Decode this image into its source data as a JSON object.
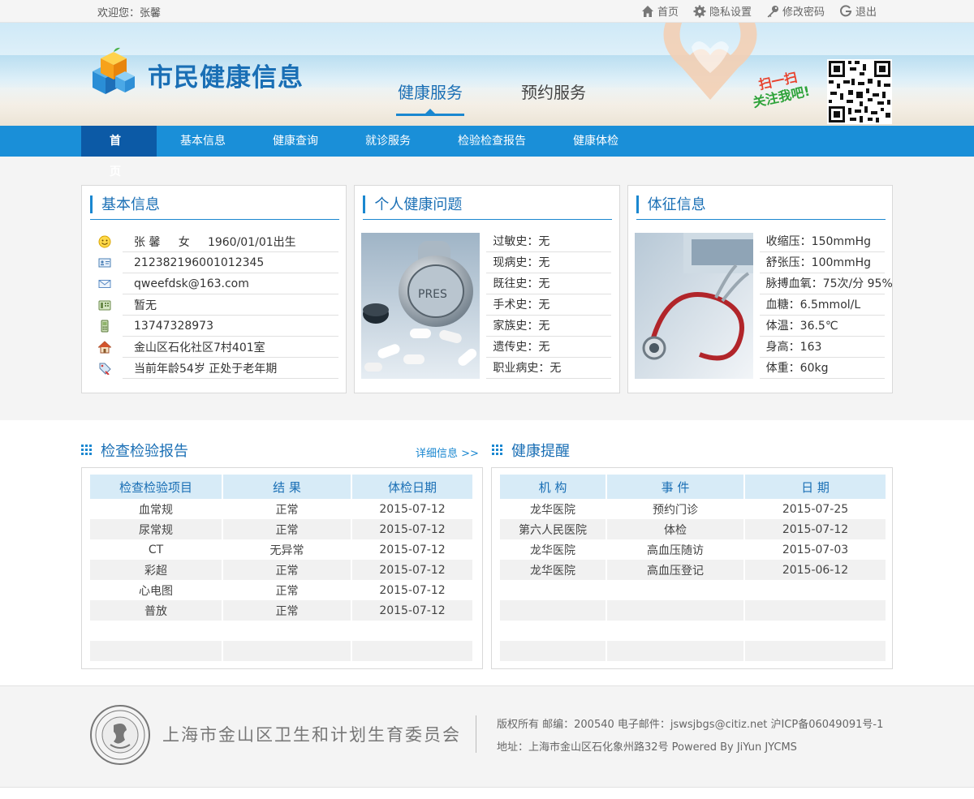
{
  "topbar": {
    "welcome": "欢迎您：张馨",
    "links": [
      {
        "icon": "home-icon",
        "label": "首页"
      },
      {
        "icon": "gear-icon",
        "label": "隐私设置"
      },
      {
        "icon": "key-icon",
        "label": "修改密码"
      },
      {
        "icon": "logout-icon",
        "label": "退出"
      }
    ]
  },
  "header": {
    "title": "市民健康信息",
    "service_tabs": [
      "健康服务",
      "预约服务"
    ],
    "active_service_tab": 0,
    "scan_line1": "扫一扫",
    "scan_line2": "关注我吧!"
  },
  "nav": {
    "items": [
      "首 页",
      "基本信息",
      "健康查询",
      "就诊服务",
      "检验检查报告",
      "健康体检"
    ],
    "active": 0,
    "color": "#1a8fd8",
    "active_color": "#0c5aa6"
  },
  "basic_info": {
    "title": "基本信息",
    "rows": [
      {
        "icon": "smiley-icon",
        "text": "张 馨     女     1960/01/01出生"
      },
      {
        "icon": "id-card-icon",
        "text": "212382196001012345"
      },
      {
        "icon": "envelope-icon",
        "text": "qweefdsk@163.com"
      },
      {
        "icon": "phone-icon",
        "text": "暂无"
      },
      {
        "icon": "mobile-icon",
        "text": "13747328973"
      },
      {
        "icon": "house-icon",
        "text": "金山区石化社区7村401室"
      },
      {
        "icon": "tag-icon",
        "text": "当前年龄54岁 正处于老年期"
      }
    ]
  },
  "health_problems": {
    "title": "个人健康问题",
    "rows": [
      "过敏史：无",
      "现病史：无",
      "既往史：无",
      "手术史：无",
      "家族史：无",
      "遗传史：无",
      "职业病史：无"
    ]
  },
  "vital_signs": {
    "title": "体征信息",
    "rows": [
      "收缩压：150mmHg",
      "舒张压：100mmHg",
      "脉搏血氧：75次/分 95%",
      "血糖：6.5mmol/L",
      "体温：36.5℃",
      "身高：163",
      "体重：60kg"
    ]
  },
  "exam_reports": {
    "title": "检查检验报告",
    "more": "详细信息 >>",
    "headers": [
      "检查检验项目",
      "结 果",
      "体检日期"
    ],
    "rows": [
      [
        "血常规",
        "正常",
        "2015-07-12"
      ],
      [
        "尿常规",
        "正常",
        "2015-07-12"
      ],
      [
        "CT",
        "无异常",
        "2015-07-12"
      ],
      [
        "彩超",
        "正常",
        "2015-07-12"
      ],
      [
        "心电图",
        "正常",
        "2015-07-12"
      ],
      [
        "普放",
        "正常",
        "2015-07-12"
      ],
      [
        "",
        "",
        ""
      ],
      [
        "",
        "",
        ""
      ]
    ]
  },
  "reminders": {
    "title": "健康提醒",
    "headers": [
      "机 构",
      "事 件",
      "日 期"
    ],
    "rows": [
      [
        "龙华医院",
        "预约门诊",
        "2015-07-25"
      ],
      [
        "第六人民医院",
        "体检",
        "2015-07-12"
      ],
      [
        "龙华医院",
        "高血压随访",
        "2015-07-03"
      ],
      [
        "龙华医院",
        "高血压登记",
        "2015-06-12"
      ],
      [
        "",
        "",
        ""
      ],
      [
        "",
        "",
        ""
      ],
      [
        "",
        "",
        ""
      ],
      [
        "",
        "",
        ""
      ]
    ]
  },
  "footer": {
    "org_name": "上海市金山区卫生和计划生育委员会",
    "line1": "版权所有  邮编：200540  电子邮件：jswsjbgs@citiz.net   沪ICP备06049091号-1",
    "line2": "地址：上海市金山区石化象州路32号    Powered By JiYun JYCMS"
  }
}
